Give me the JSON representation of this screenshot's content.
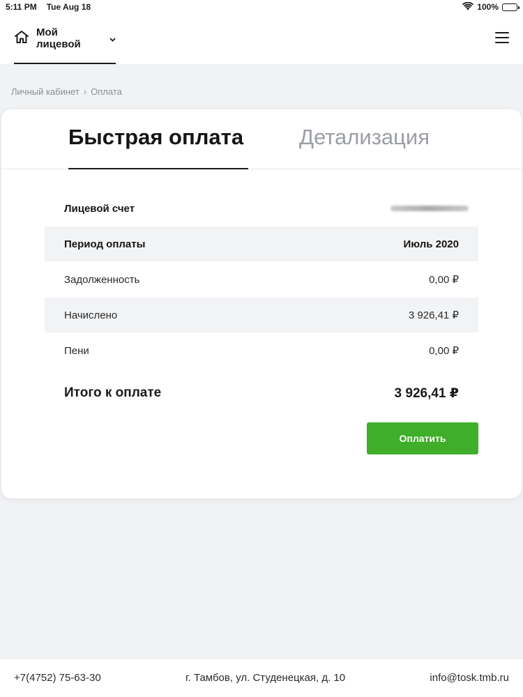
{
  "status_bar": {
    "time": "5:11 PM",
    "date": "Tue Aug 18",
    "battery": "100%",
    "icons": [
      "wifi-icon",
      "battery-icon"
    ]
  },
  "header": {
    "account_label": "Мой лицевой",
    "icons": [
      "home-icon",
      "chevron-down-icon",
      "hamburger-menu-icon"
    ]
  },
  "breadcrumb": {
    "items": [
      "Личный кабинет",
      "Оплата"
    ],
    "separator": "›"
  },
  "tabs": [
    {
      "label": "Быстрая оплата",
      "active": true
    },
    {
      "label": "Детализация",
      "active": false
    }
  ],
  "payment": {
    "rows": [
      {
        "label": "Лицевой счет",
        "value": ""
      },
      {
        "label": "Период оплаты",
        "value": "Июль 2020"
      },
      {
        "label": "Задолженность",
        "value": "0,00 ₽"
      },
      {
        "label": "Начислено",
        "value": "3 926,41 ₽"
      },
      {
        "label": "Пени",
        "value": "0,00 ₽"
      }
    ],
    "total_label": "Итого к оплате",
    "total_value": "3 926,41 ₽",
    "pay_button": "Оплатить"
  },
  "footer": {
    "phone": "+7(4752) 75-63-30",
    "address": "г. Тамбов, ул. Студенецкая, д. 10",
    "email": "info@tosk.tmb.ru"
  },
  "colors": {
    "accent_green": "#3fae2a",
    "page_background": "#f1f2f4",
    "shaded_row": "#f2f3f5",
    "inactive_tab": "#9b9ea4"
  }
}
